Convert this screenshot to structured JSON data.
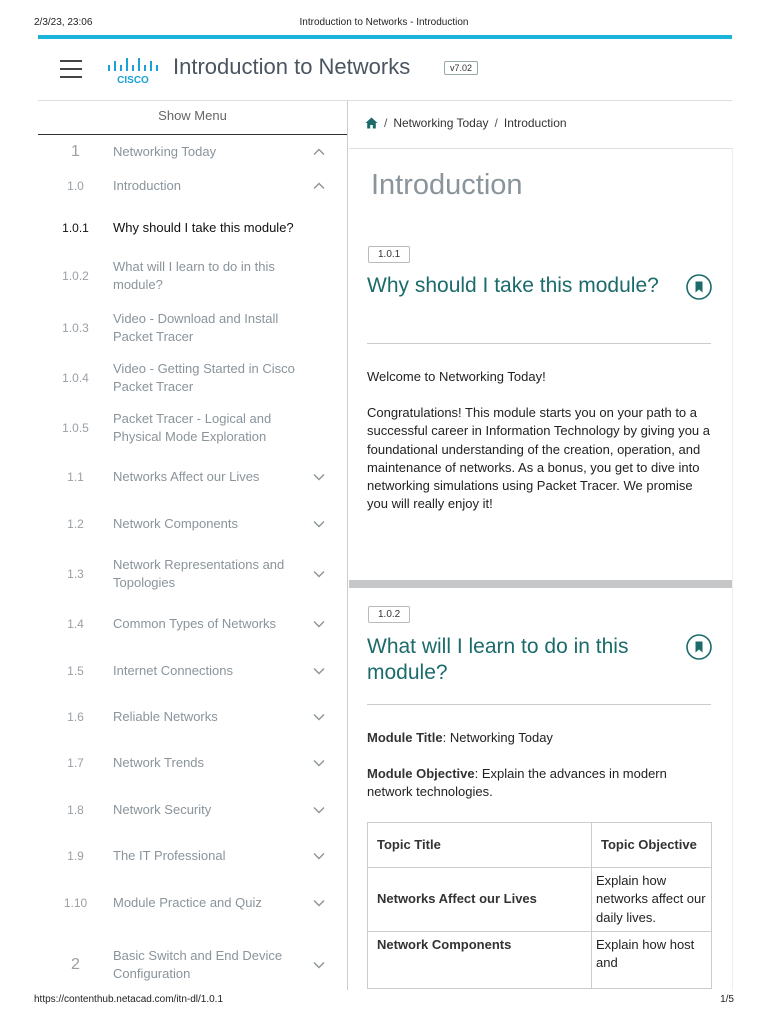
{
  "print": {
    "date": "2/3/23, 23:06",
    "title": "Introduction to Networks - Introduction",
    "url": "https://contenthub.netacad.com/itn-dl/1.0.1",
    "page": "1/5"
  },
  "header": {
    "logo_text": "CISCO",
    "title": "Introduction to Networks",
    "version": "v7.02"
  },
  "sidebar": {
    "show_menu": "Show Menu",
    "items": [
      {
        "num": "1",
        "label": "Networking Today",
        "chevron": "up"
      },
      {
        "num": "1.0",
        "label": "Introduction",
        "chevron": "up"
      },
      {
        "num": "1.0.1",
        "label": "Why should I take this module?",
        "active": true
      },
      {
        "num": "1.0.2",
        "label": "What will I learn to do in this module?"
      },
      {
        "num": "1.0.3",
        "label": "Video - Download and Install Packet Tracer"
      },
      {
        "num": "1.0.4",
        "label": "Video - Getting Started in Cisco Packet Tracer"
      },
      {
        "num": "1.0.5",
        "label": "Packet Tracer - Logical and Physical Mode Exploration"
      },
      {
        "num": "1.1",
        "label": "Networks Affect our Lives",
        "chevron": "down"
      },
      {
        "num": "1.2",
        "label": "Network Components",
        "chevron": "down"
      },
      {
        "num": "1.3",
        "label": "Network Representations and Topologies",
        "chevron": "down"
      },
      {
        "num": "1.4",
        "label": "Common Types of Networks",
        "chevron": "down"
      },
      {
        "num": "1.5",
        "label": "Internet Connections",
        "chevron": "down"
      },
      {
        "num": "1.6",
        "label": "Reliable Networks",
        "chevron": "down"
      },
      {
        "num": "1.7",
        "label": "Network Trends",
        "chevron": "down"
      },
      {
        "num": "1.8",
        "label": "Network Security",
        "chevron": "down"
      },
      {
        "num": "1.9",
        "label": "The IT Professional",
        "chevron": "down"
      },
      {
        "num": "1.10",
        "label": "Module Practice and Quiz",
        "chevron": "down"
      },
      {
        "num": "2",
        "label": "Basic Switch and End Device Configuration",
        "chevron": "down"
      }
    ]
  },
  "breadcrumb": {
    "items": [
      "Networking Today",
      "Introduction"
    ]
  },
  "content": {
    "page_title": "Introduction",
    "sections": [
      {
        "badge": "1.0.1",
        "title": "Why should I take this module?",
        "welcome": "Welcome to Networking Today!",
        "body": "Congratulations! This module starts you on your path to a successful career in Information Technology by giving you a foundational understanding of the creation, operation, and maintenance of networks. As a bonus, you get to dive into networking simulations using Packet Tracer. We promise you will really enjoy it!"
      },
      {
        "badge": "1.0.2",
        "title": "What will I learn to do in this module?",
        "module_title_label": "Module Title",
        "module_title_value": ": Networking Today",
        "module_objective_label": "Module Objective",
        "module_objective_value": ": Explain the advances in modern network technologies."
      }
    ],
    "table": {
      "headers": [
        "Topic Title",
        "Topic Objective"
      ],
      "rows": [
        [
          "Networks Affect our Lives",
          "Explain how networks affect our daily lives."
        ],
        [
          "Network Components",
          "Explain how host and"
        ]
      ]
    }
  },
  "colors": {
    "accent_bar": "#1ab3da",
    "section_title": "#1c6b6b",
    "logo": "#1ba0d7"
  }
}
